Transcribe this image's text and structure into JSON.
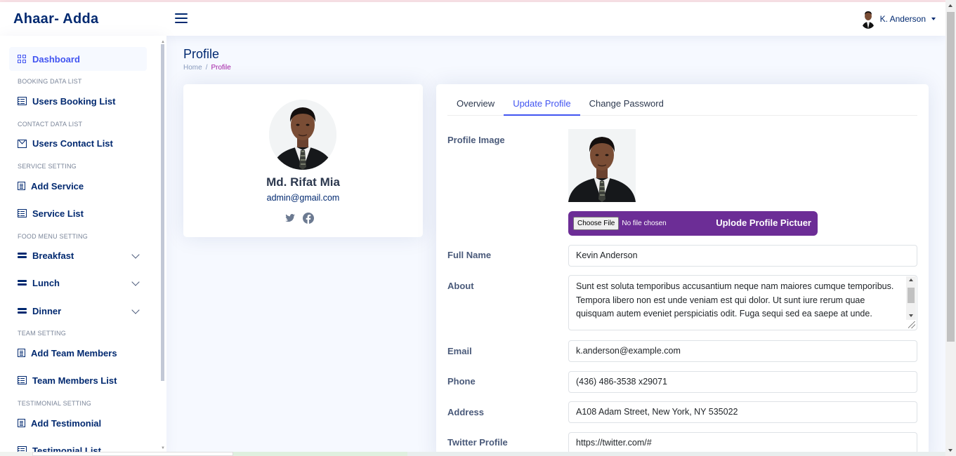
{
  "brand": {
    "logo": "Ahaar- Adda"
  },
  "header": {
    "user_name": "K. Anderson"
  },
  "sidebar": {
    "items": [
      {
        "label": "Dashboard",
        "icon": "grid-icon"
      },
      {
        "heading": "BOOKING DATA LIST"
      },
      {
        "label": "Users Booking List",
        "icon": "list-icon"
      },
      {
        "heading": "CONTACT DATA LIST"
      },
      {
        "label": "Users Contact List",
        "icon": "envelope-icon"
      },
      {
        "heading": "SERVICE SETTING"
      },
      {
        "label": "Add Service",
        "icon": "document-icon"
      },
      {
        "label": "Service List",
        "icon": "list-icon"
      },
      {
        "heading": "FOOD MENU SETTING"
      },
      {
        "label": "Breakfast",
        "icon": "menu-bar-icon"
      },
      {
        "label": "Lunch",
        "icon": "menu-bar-icon"
      },
      {
        "label": "Dinner",
        "icon": "menu-bar-icon"
      },
      {
        "heading": "TEAM SETTING"
      },
      {
        "label": "Add Team Members",
        "icon": "document-icon"
      },
      {
        "label": "Team Members List",
        "icon": "list-icon"
      },
      {
        "heading": "TESTIMONIAL SETTING"
      },
      {
        "label": "Add Testimonial",
        "icon": "document-icon"
      },
      {
        "label": "Testimonial List",
        "icon": "list-icon"
      }
    ]
  },
  "page": {
    "title": "Profile",
    "breadcrumb": {
      "home": "Home",
      "separator": "/",
      "current": "Profile"
    }
  },
  "profile_card": {
    "name": "Md. Rifat Mia",
    "email": "admin@gmail.com",
    "social_icons": [
      "twitter-icon",
      "facebook-icon"
    ]
  },
  "tabs": [
    "Overview",
    "Update Profile",
    "Change Password"
  ],
  "form": {
    "profile_image_label": "Profile Image",
    "choose_file": "Choose File",
    "no_file": "No file chosen",
    "upload_label": "Uplode Profile Pictuer",
    "full_name_label": "Full Name",
    "full_name": "Kevin Anderson",
    "about_label": "About",
    "about": "Sunt est soluta temporibus accusantium neque nam maiores cumque temporibus. Tempora libero non est unde veniam est qui dolor. Ut sunt iure rerum quae quisquam autem eveniet perspiciatis odit. Fuga sequi sed ea saepe at unde.",
    "email_label": "Email",
    "email": "k.anderson@example.com",
    "phone_label": "Phone",
    "phone": "(436) 486-3538 x29071",
    "address_label": "Address",
    "address": "A108 Adam Street, New York, NY 535022",
    "twitter_label": "Twitter Profile",
    "twitter": "https://twitter.com/#"
  },
  "colors": {
    "primary": "#4154f1",
    "navy": "#012970",
    "upload_bg": "#6c2d96",
    "breadcrumb_active": "#a21ea5"
  }
}
